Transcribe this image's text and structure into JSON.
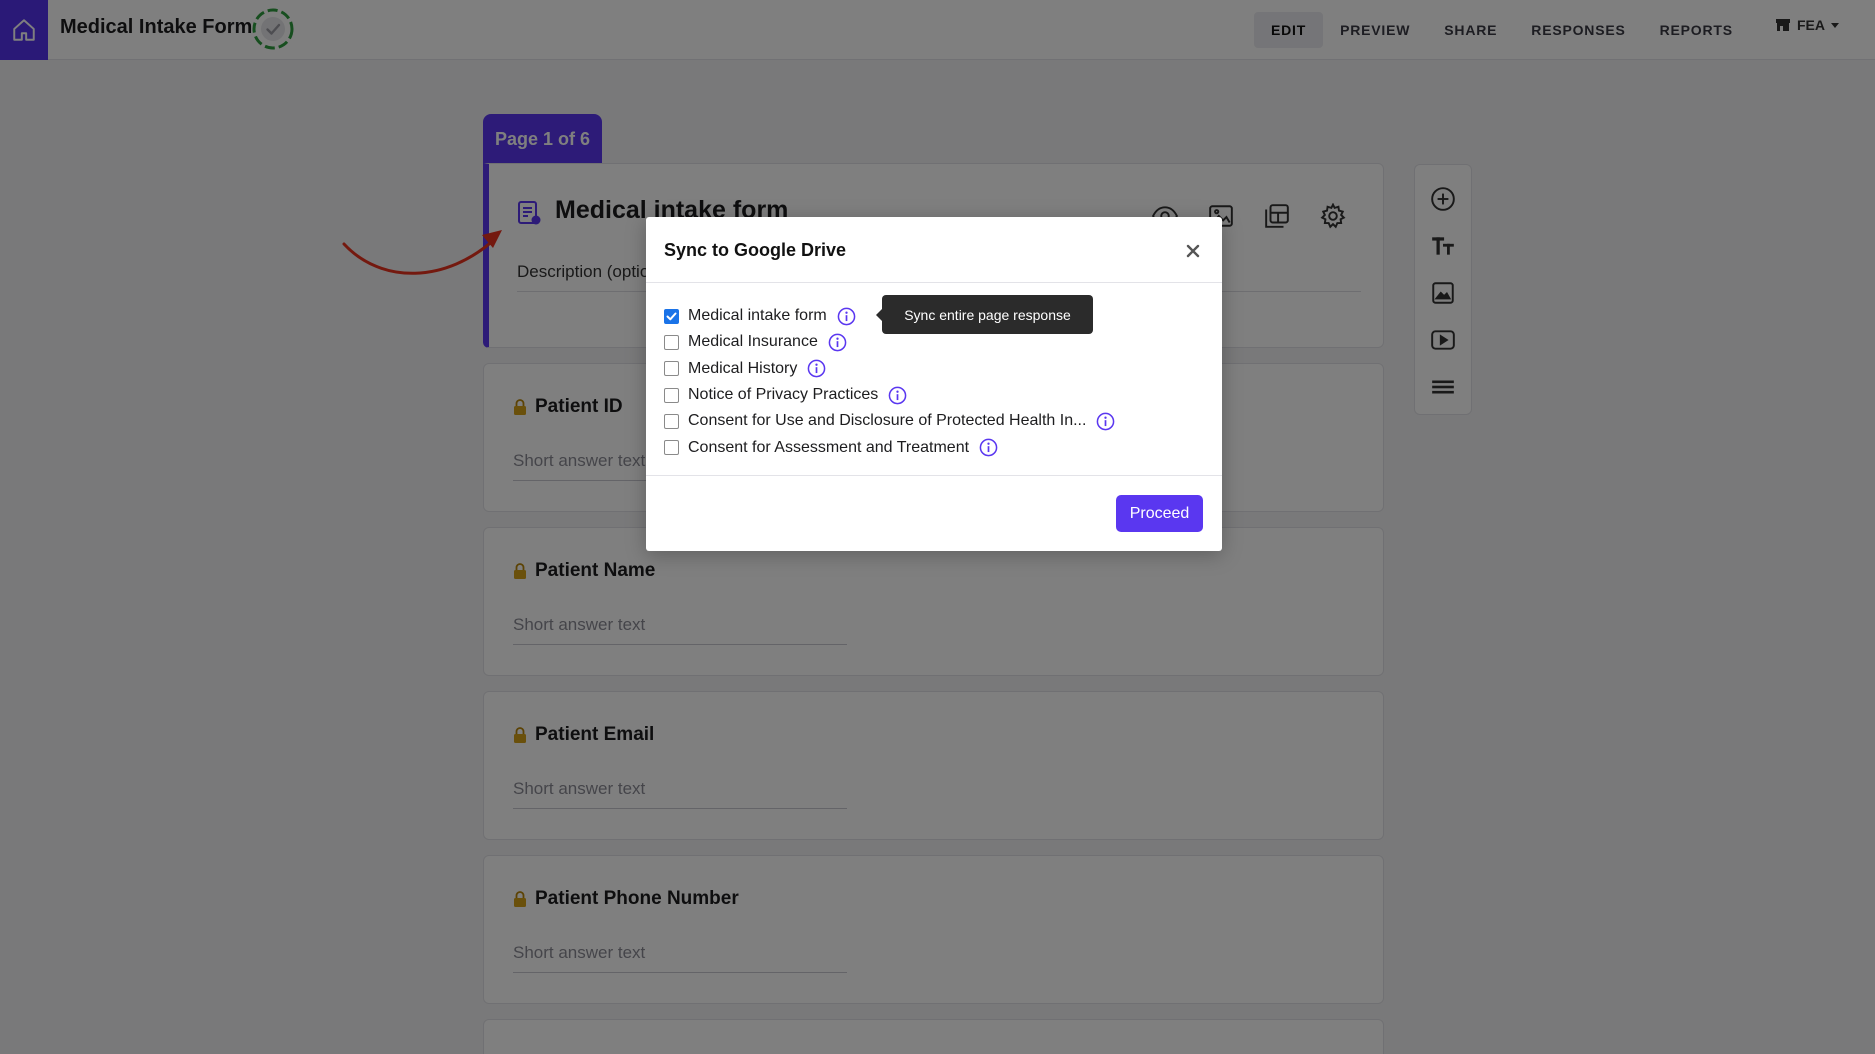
{
  "app": {
    "title": "Medical Intake Form"
  },
  "nav": {
    "tabs": [
      "EDIT",
      "PREVIEW",
      "SHARE",
      "RESPONSES",
      "REPORTS"
    ],
    "active": "EDIT",
    "workspace": "FEA"
  },
  "form": {
    "page_indicator": "Page 1 of 6",
    "title": "Medical intake form",
    "description_placeholder": "Description (optional)",
    "questions": [
      {
        "label": "Patient ID",
        "placeholder": "Short answer text"
      },
      {
        "label": "Patient Name",
        "placeholder": "Short answer text"
      },
      {
        "label": "Patient Email",
        "placeholder": "Short answer text"
      },
      {
        "label": "Patient Phone Number",
        "placeholder": "Short answer text"
      }
    ]
  },
  "modal": {
    "title": "Sync to Google Drive",
    "options": [
      {
        "label": "Medical intake form",
        "checked": true
      },
      {
        "label": "Medical Insurance",
        "checked": false
      },
      {
        "label": "Medical History",
        "checked": false
      },
      {
        "label": "Notice of Privacy Practices",
        "checked": false
      },
      {
        "label": "Consent for Use and Disclosure of Protected Health In...",
        "checked": false
      },
      {
        "label": "Consent for Assessment and Treatment",
        "checked": false
      }
    ],
    "tooltip": "Sync entire page response",
    "proceed_label": "Proceed"
  },
  "icons": {
    "home": "home-icon",
    "status": "sync-status-icon",
    "workspace": "store-icon",
    "form": "form-doc-icon",
    "header_tools": [
      "eye-icon",
      "image-icon",
      "layout-icon",
      "gear-icon"
    ],
    "side_tools": [
      "add-circle-icon",
      "text-size-icon",
      "image-icon",
      "video-icon",
      "section-icon"
    ],
    "close": "close-icon",
    "info": "info-icon"
  },
  "colors": {
    "brand": "#5a37f0",
    "checkbox": "#1a73e8",
    "annotation_arrow": "#e8321e",
    "status_ring": "#2e9d3e"
  }
}
